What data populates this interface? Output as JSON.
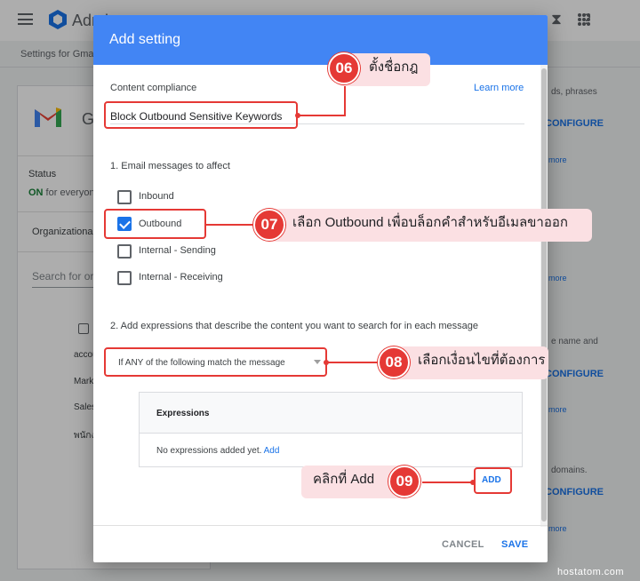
{
  "topbar": {
    "app_name": "Admin",
    "icons": [
      "search-icon",
      "hourglass-icon",
      "help-icon",
      "apps-icon"
    ]
  },
  "breadcrumb": "Settings for Gmail",
  "left_panel": {
    "app_title": "Gmail",
    "status_label": "Status",
    "status_on": "ON",
    "status_rest": " for everyone",
    "org_units_label": "Organizational Units",
    "search_placeholder": "Search for organizational units",
    "items": [
      "accounts",
      "Marketing",
      "Sales",
      "พนักงาน"
    ]
  },
  "right_panel": {
    "snippets": [
      "ds, phrases",
      "e name and",
      "domains."
    ],
    "configure_label": "CONFIGURE",
    "more_label": "more"
  },
  "dialog": {
    "title": "Add setting",
    "section_title": "Content compliance",
    "learn_more": "Learn more",
    "setting_name": "Block Outbound Sensitive Keywords",
    "section1_title": "1. Email messages to affect",
    "checkboxes": [
      {
        "label": "Inbound",
        "checked": false
      },
      {
        "label": "Outbound",
        "checked": true
      },
      {
        "label": "Internal - Sending",
        "checked": false
      },
      {
        "label": "Internal - Receiving",
        "checked": false
      }
    ],
    "section2_title": "2. Add expressions that describe the content you want to search for in each message",
    "match_select": "If ANY of the following match the message",
    "expressions_header": "Expressions",
    "expressions_empty": "No expressions added yet.",
    "expressions_add_link": "Add",
    "add_button": "ADD",
    "cancel_button": "CANCEL",
    "save_button": "SAVE"
  },
  "annotations": [
    {
      "num": "06",
      "text": "ตั้งชื่อกฎ"
    },
    {
      "num": "07",
      "text": "เลือก Outbound เพื่อบล็อกคำสำหรับอีเมลขาออก"
    },
    {
      "num": "08",
      "text": "เลือกเงื่อนไขที่ต้องการ"
    },
    {
      "num": "09",
      "text": "คลิกที่ Add"
    }
  ],
  "watermark": "hostatom.com",
  "colors": {
    "dialog_header": "#4285f4",
    "accent": "#1a73e8",
    "annotation": "#e53935",
    "annotation_bg": "#fbe0e3"
  }
}
